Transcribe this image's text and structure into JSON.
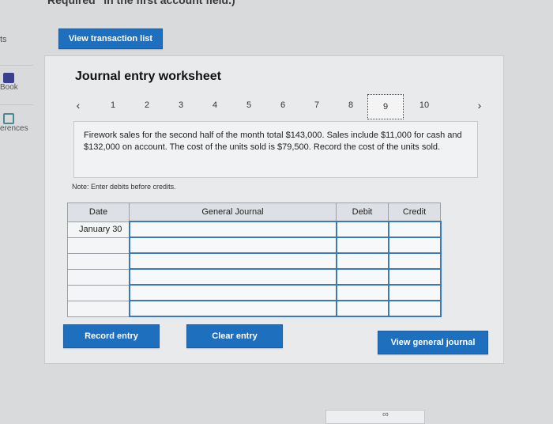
{
  "banner": "Required\" in the first account field.)",
  "sidebar": {
    "top_fragment": "ts",
    "items": [
      {
        "label": "Book",
        "icon": "book-icon"
      },
      {
        "label": "erences",
        "icon": "references-icon"
      }
    ]
  },
  "buttons": {
    "view_transactions": "View transaction list",
    "record_entry": "Record entry",
    "clear_entry": "Clear entry",
    "view_general_journal": "View general journal"
  },
  "worksheet": {
    "title": "Journal entry worksheet",
    "pages": [
      "1",
      "2",
      "3",
      "4",
      "5",
      "6",
      "7",
      "8",
      "9",
      "10"
    ],
    "active_page": "9",
    "problem_text": "Firework sales for the second half of the month total $143,000. Sales include $11,000 for cash and $132,000 on account. The cost of the units sold is $79,500. Record the cost of the units sold.",
    "note": "Note: Enter debits before credits."
  },
  "journal": {
    "headers": {
      "date": "Date",
      "account": "General Journal",
      "debit": "Debit",
      "credit": "Credit"
    },
    "first_date": "January 30"
  },
  "colors": {
    "accent": "#1f6fbf",
    "field_border": "#3d7ab3"
  }
}
